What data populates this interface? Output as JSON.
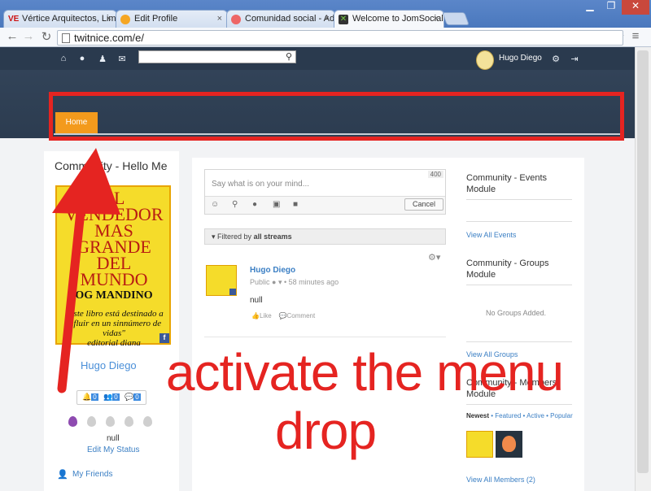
{
  "browser": {
    "tabs": [
      {
        "favicon": "VE",
        "title": "Vértice Arquitectos, Lima",
        "active": false
      },
      {
        "favicon": "joomla-icon",
        "title": "Edit Profile",
        "active": false
      },
      {
        "favicon": "joomla-icon",
        "title": "Comunidad social - Admi",
        "active": false
      },
      {
        "favicon": "jomsocial-icon",
        "title": "Welcome to JomSocial",
        "active": true
      }
    ],
    "url": "twitnice.com/e/"
  },
  "site": {
    "top_icons": [
      "home-icon",
      "globe-icon",
      "users-icon",
      "mail-icon"
    ],
    "search_placeholder": "",
    "user_name": "Hugo Diego",
    "menu": {
      "home_label": "Home"
    }
  },
  "left": {
    "title": "Community - Hello Me",
    "cover": {
      "lines": [
        "EL",
        "VENDEDOR",
        "MAS",
        "GRANDE",
        "DEL",
        "MUNDO"
      ],
      "author": "OG MANDINO",
      "tagline": "\"Este libro está destinado a influir en un sinnúmero de vidas\"",
      "publisher": "editorial diana"
    },
    "profile_name": "Hugo Diego",
    "badges": [
      {
        "icon": "bell-icon",
        "count": "0"
      },
      {
        "icon": "users-icon",
        "count": "0"
      },
      {
        "icon": "comments-icon",
        "count": "0"
      }
    ],
    "status": "null",
    "edit_status": "Edit My Status",
    "friends_link": "My Friends"
  },
  "stream": {
    "composer_placeholder": "Say what is on your mind...",
    "char_count": "400",
    "cancel_label": "Cancel",
    "filter_prefix": "Filtered by",
    "filter_value": "all streams",
    "post": {
      "author": "Hugo Diego",
      "privacy": "Public",
      "time": "58 minutes ago",
      "body": "null",
      "like": "Like",
      "comment": "Comment"
    }
  },
  "right": {
    "events_title": "Community - Events Module",
    "events_link": "View All Events",
    "groups_title": "Community - Groups Module",
    "groups_empty": "No Groups Added.",
    "groups_link": "View All Groups",
    "members_title": "Community - Members Module",
    "members_tabs": {
      "newest": "Newest",
      "featured": "Featured",
      "active": "Active",
      "popular": "Popular"
    },
    "members_link": "View All Members (2)"
  },
  "annotation": {
    "line1": "activate the menu",
    "line2": "drop",
    "color": "#e52421"
  }
}
